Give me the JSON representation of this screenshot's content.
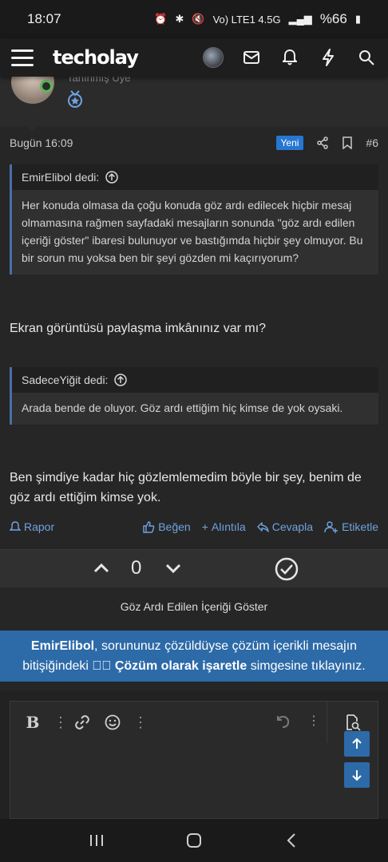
{
  "status": {
    "time": "18:07",
    "network": "Vo) LTE1 4.5G",
    "battery": "%66"
  },
  "app": {
    "logo": "techolay"
  },
  "post": {
    "user_cut": "Tanınmış Üye",
    "date": "Bugün 16:09",
    "badge": "Yeni",
    "number": "#6",
    "quote1": {
      "author": "EmirElibol dedi:",
      "text": "Her konuda olmasa da çoğu konuda göz ardı edilecek hiçbir mesaj olmamasına rağmen sayfadaki mesajların sonunda \"göz ardı edilen içeriği göster\" ibaresi bulunuyor ve bastığımda hiçbir şey olmuyor. Bu bir sorun mu yoksa ben bir şeyi gözden mi kaçırıyorum?"
    },
    "message1": "Ekran görüntüsü paylaşma imkânınız var mı?",
    "quote2": {
      "author": "SadeceYiğit dedi:",
      "text": "Arada bende de oluyor. Göz ardı ettiğim hiç kimse de yok oysaki."
    },
    "message2": "Ben şimdiye kadar hiç gözlemlemedim böyle bir şey, benim de göz ardı ettiğim kimse yok.",
    "actions": {
      "report": "Rapor",
      "like": "Beğen",
      "quote": "Alıntıla",
      "reply": "Cevapla",
      "tag": "Etiketle"
    },
    "score": "0"
  },
  "show_ignored": "Göz Ardı Edilen İçeriği Göster",
  "notice": {
    "user": "EmirElibol",
    "part1": ", sorununuz çözüldüyse çözüm içerikli mesajın bitişiğindeki ",
    "bold": "Çözüm olarak işaretle",
    "part2": " simgesine tıklayınız."
  },
  "colors": {
    "accent": "#2d6aa8",
    "link": "#6fa3e0",
    "online": "#5cb85c",
    "badge": "#2577d1"
  }
}
